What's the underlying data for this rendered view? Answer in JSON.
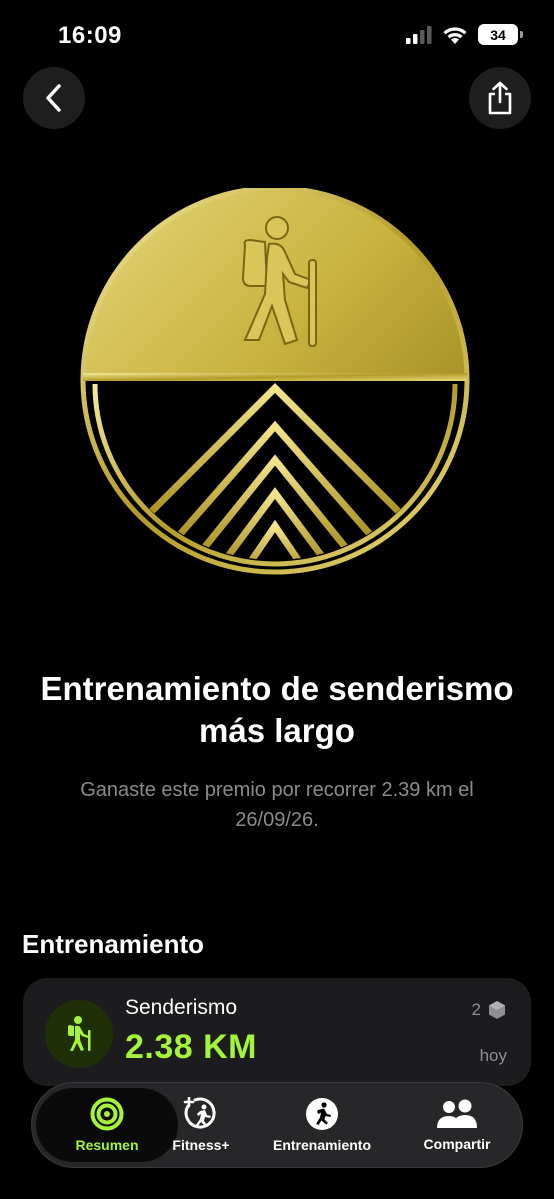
{
  "status_bar": {
    "time": "16:09",
    "battery": "34"
  },
  "nav": {
    "back_icon": "chevron-left-icon",
    "share_icon": "share-icon"
  },
  "award": {
    "medal_icon": "hiking-medal",
    "title": "Entrenamiento de senderismo más largo",
    "description": "Ganaste este premio por recorrer 2.39 km el 26/09/26."
  },
  "section": {
    "title": "Entrenamiento"
  },
  "workout": {
    "name": "Senderismo",
    "distance": "2.38 KM",
    "count": "2",
    "date": "hoy",
    "icon": "hiker-icon",
    "accent_color": "#a4f43a"
  },
  "tabs": [
    {
      "label": "Resumen",
      "icon": "activity-rings-icon",
      "active": true
    },
    {
      "label": "Fitness+",
      "icon": "fitness-plus-icon",
      "active": false
    },
    {
      "label": "Entrenamiento",
      "icon": "running-icon",
      "active": false
    },
    {
      "label": "Compartir",
      "icon": "people-icon",
      "active": false
    }
  ]
}
